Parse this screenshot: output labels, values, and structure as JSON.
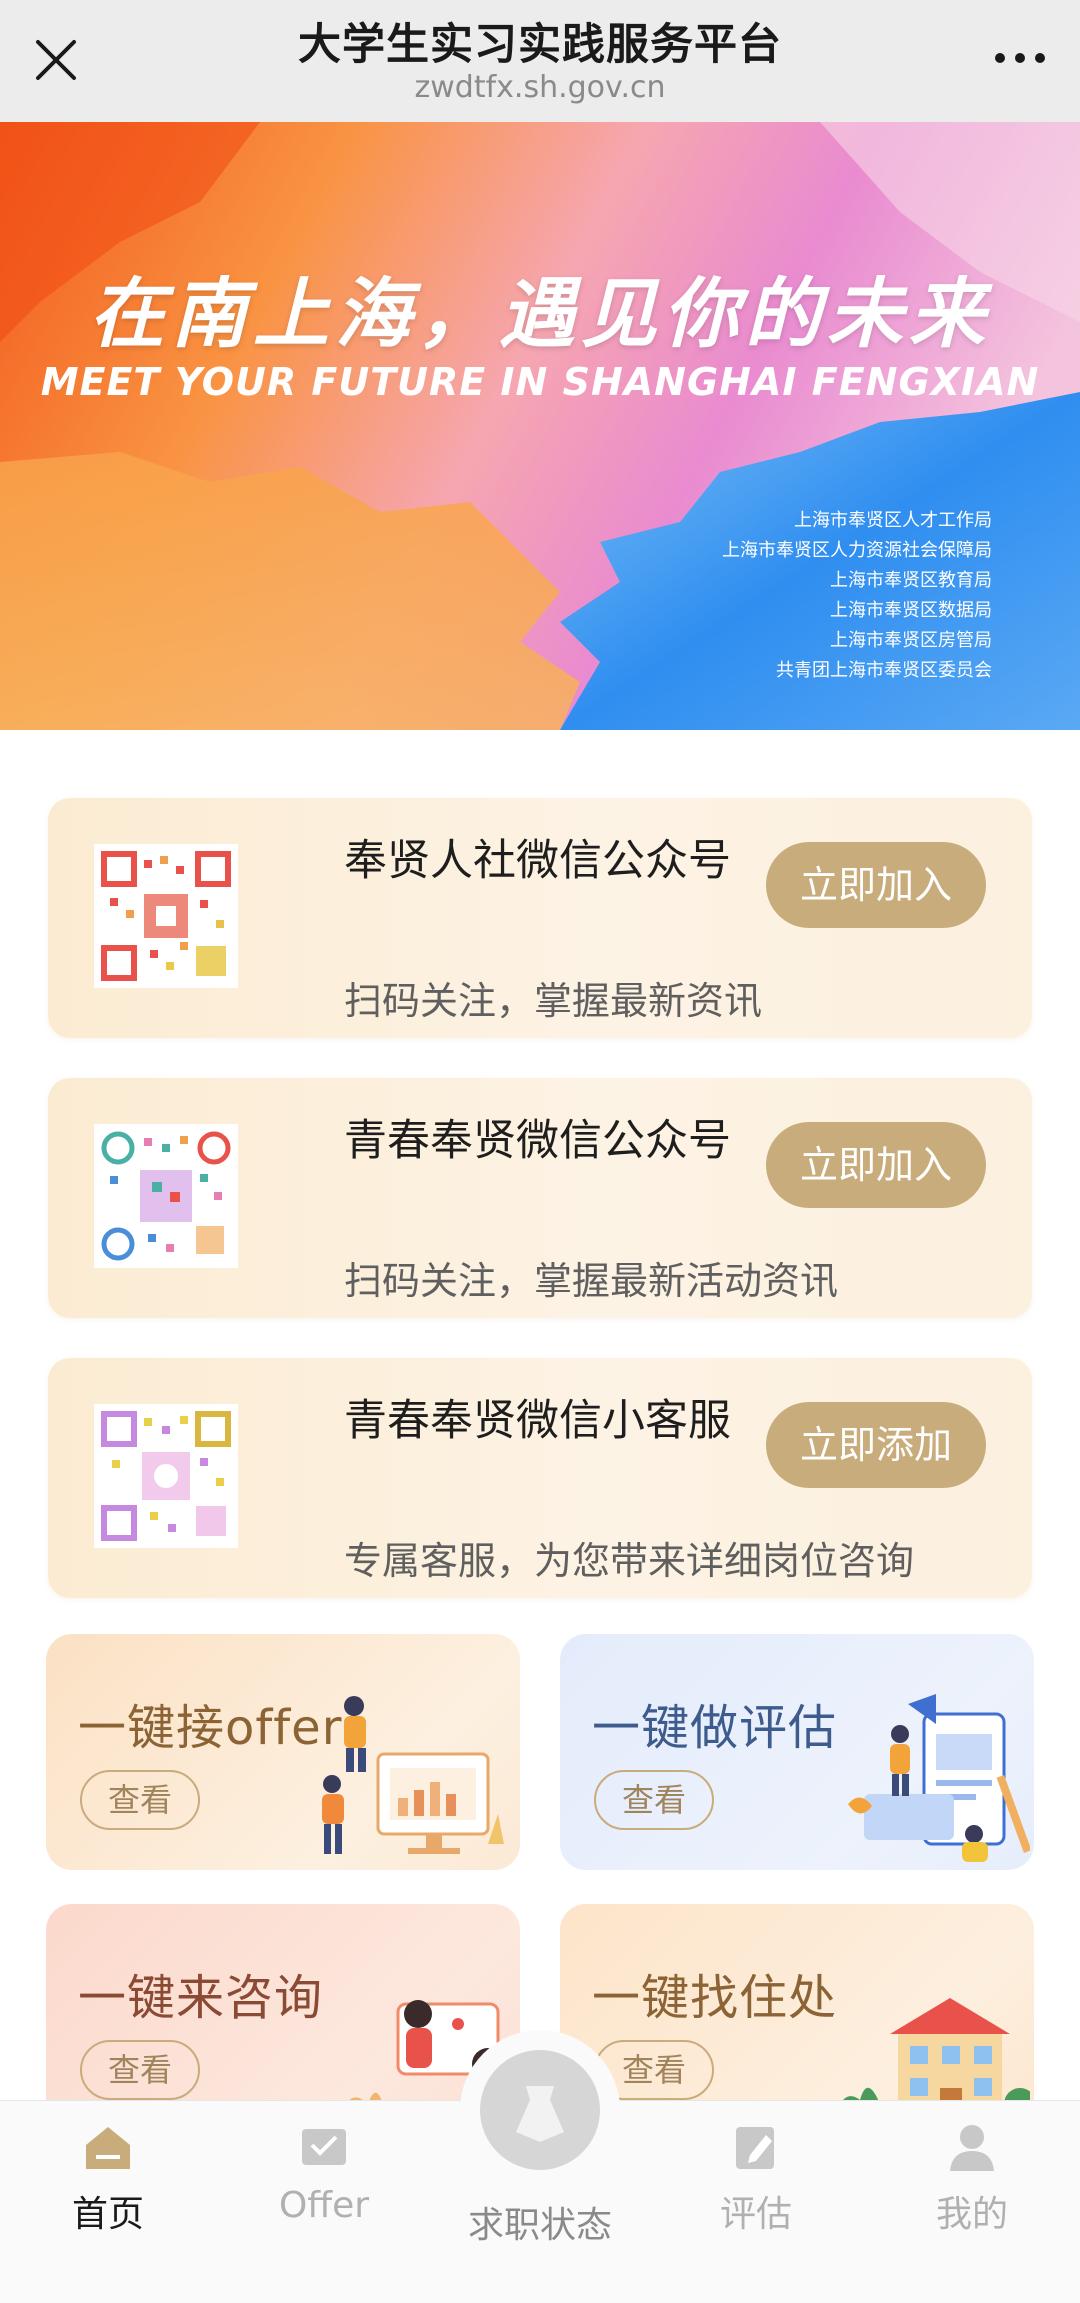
{
  "header": {
    "title": "大学生实习实践服务平台",
    "url": "zwdtfx.sh.gov.cn",
    "close_icon": "close-icon",
    "more_icon": "more-dots-icon"
  },
  "banner": {
    "slogan": "在南上海，遇见你的未来",
    "subtitle": "MEET YOUR FUTURE IN SHANGHAI FENGXIAN",
    "organizations": [
      "上海市奉贤区人才工作局",
      "上海市奉贤区人力资源社会保障局",
      "上海市奉贤区教育局",
      "上海市奉贤区数据局",
      "上海市奉贤区房管局",
      "共青团上海市奉贤区委员会"
    ]
  },
  "cards": [
    {
      "title": "奉贤人社微信公众号",
      "desc": "扫码关注，掌握最新资讯",
      "button": "立即加入"
    },
    {
      "title": "青春奉贤微信公众号",
      "desc": "扫码关注，掌握最新活动资讯",
      "button": "立即加入"
    },
    {
      "title": "青春奉贤微信小客服",
      "desc": "专属客服，为您带来详细岗位咨询",
      "button": "立即添加"
    }
  ],
  "tiles": [
    {
      "label": "一键接offer",
      "view": "查看"
    },
    {
      "label": "一键做评估",
      "view": "查看"
    },
    {
      "label": "一键来咨询",
      "view": "查看"
    },
    {
      "label": "一键找住处",
      "view": "查看"
    }
  ],
  "nav": {
    "home": "首页",
    "offer": "Offer",
    "status": "求职状态",
    "eval": "评估",
    "mine": "我的"
  },
  "colors": {
    "accent_gold": "#c8ac7c",
    "nav_active": "#1a1a1a",
    "nav_inactive": "#b0b0b0"
  }
}
